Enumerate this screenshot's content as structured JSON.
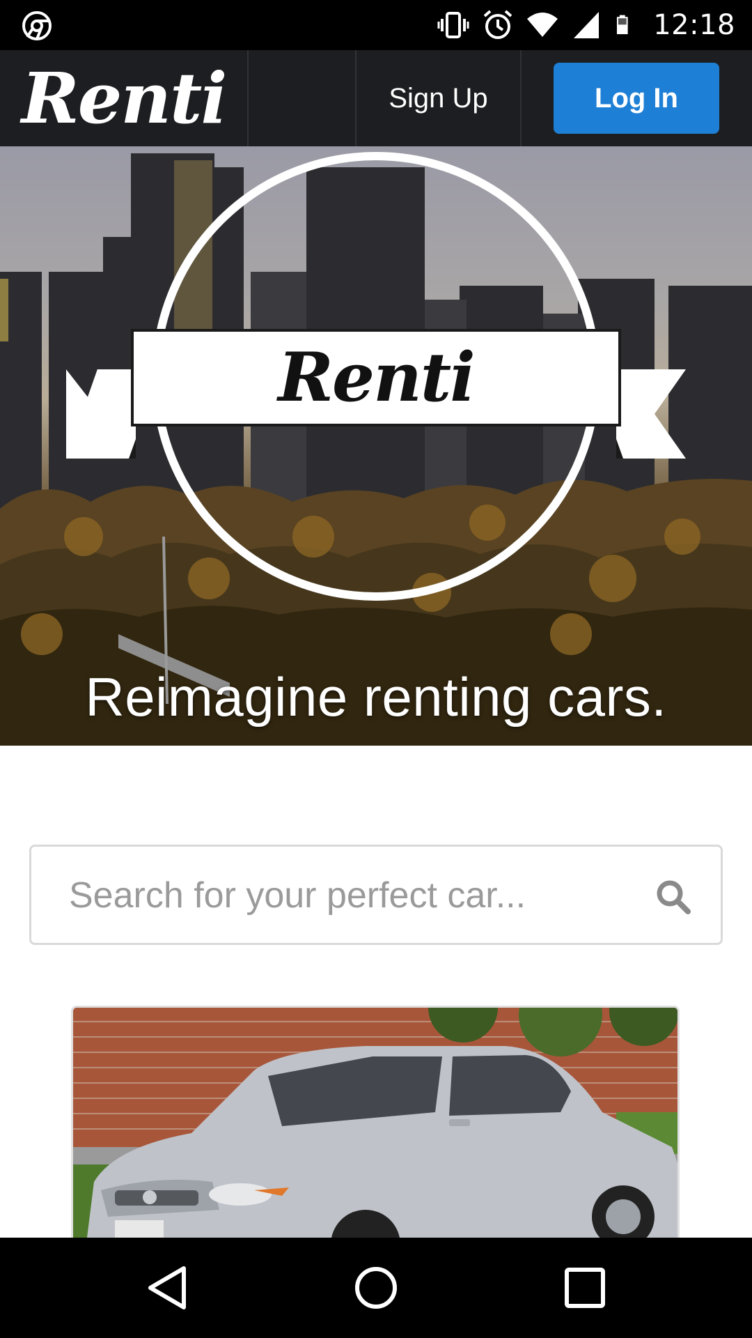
{
  "status_bar": {
    "time": "12:18",
    "icons": [
      "chrome-icon",
      "vibrate-icon",
      "alarm-icon",
      "wifi-icon",
      "signal-icon",
      "battery-icon"
    ]
  },
  "nav": {
    "brand": "Renti",
    "signup_label": "Sign Up",
    "login_label": "Log In",
    "accent_color": "#1e7fd6"
  },
  "hero": {
    "logo_text": "Renti",
    "tagline": "Reimagine renting cars."
  },
  "search": {
    "placeholder": "Search for your perfect car...",
    "value": "",
    "icon": "search-icon"
  },
  "listing": {
    "image_subject": "silver sedan"
  },
  "system_nav": {
    "buttons": [
      "back-icon",
      "home-icon",
      "recents-icon"
    ]
  }
}
